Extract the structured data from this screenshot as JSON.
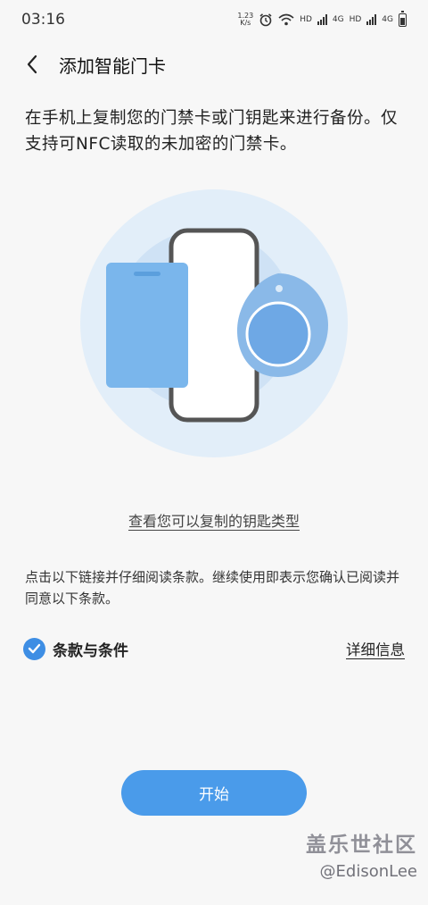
{
  "status_bar": {
    "time": "03:16",
    "net_speed_value": "1.23",
    "net_speed_unit": "K/s",
    "hd1": "HD",
    "net1": "4G",
    "hd2": "HD",
    "net2": "4G"
  },
  "header": {
    "back_icon": "chevron-left-icon",
    "title": "添加智能门卡"
  },
  "intro_text": "在手机上复制您的门禁卡或门钥匙来进行备份。仅支持可NFC读取的未加密的门禁卡。",
  "link_types": "查看您可以复制的钥匙类型",
  "terms_text": "点击以下链接并仔细阅读条款。继续使用即表示您确认已阅读并同意以下条款。",
  "terms": {
    "checked": true,
    "label": "条款与条件",
    "details_link": "详细信息"
  },
  "start_button": "开始",
  "watermark": {
    "title": "盖乐世社区",
    "user": "@EdisonLee"
  },
  "colors": {
    "accent": "#4a9bea",
    "checkbox": "#3e8ee4",
    "illustration_bg_outer": "#e2eef9",
    "illustration_card": "#7ab6ec",
    "illustration_fob": "#8ab9e8"
  }
}
